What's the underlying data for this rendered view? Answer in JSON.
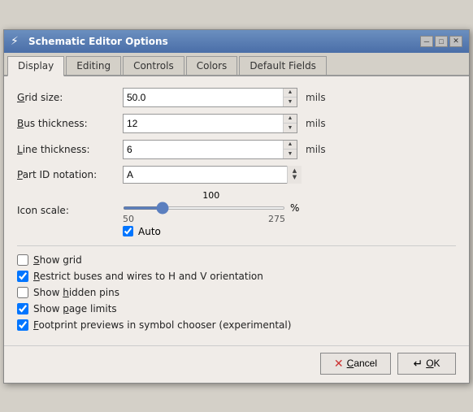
{
  "window": {
    "title": "Schematic Editor Options",
    "icon": "⚙"
  },
  "titlebar_buttons": {
    "minimize": "─",
    "maximize": "□",
    "close": "✕"
  },
  "tabs": [
    {
      "id": "display",
      "label": "Display",
      "underline": "D",
      "active": true
    },
    {
      "id": "editing",
      "label": "Editing",
      "underline": "E",
      "active": false
    },
    {
      "id": "controls",
      "label": "Controls",
      "underline": "C",
      "active": false
    },
    {
      "id": "colors",
      "label": "Colors",
      "underline": "o",
      "active": false
    },
    {
      "id": "default-fields",
      "label": "Default Fields",
      "underline": "F",
      "active": false
    }
  ],
  "form": {
    "grid_size_label": "Grid size:",
    "grid_size_value": "50.0",
    "grid_size_unit": "mils",
    "bus_thickness_label": "Bus thickness:",
    "bus_thickness_value": "12",
    "bus_thickness_unit": "mils",
    "line_thickness_label": "Line thickness:",
    "line_thickness_value": "6",
    "line_thickness_unit": "mils",
    "part_id_label": "Part ID notation:",
    "part_id_value": "A",
    "icon_scale_label": "Icon scale:",
    "icon_scale_value": "100",
    "icon_scale_min": "50",
    "icon_scale_max": "275",
    "icon_scale_unit": "%",
    "auto_label": "Auto",
    "auto_checked": true
  },
  "checkboxes": [
    {
      "id": "show-grid",
      "label": "Show grid",
      "checked": false,
      "underline": "S"
    },
    {
      "id": "restrict-buses",
      "label": "Restrict buses and wires to H and V orientation",
      "checked": true,
      "underline": "R"
    },
    {
      "id": "show-hidden",
      "label": "Show hidden pins",
      "checked": false,
      "underline": "h"
    },
    {
      "id": "show-page",
      "label": "Show page limits",
      "checked": true,
      "underline": "p"
    },
    {
      "id": "footprint-previews",
      "label": "Footprint previews in symbol chooser (experimental)",
      "checked": true,
      "underline": "F"
    }
  ],
  "buttons": {
    "cancel_label": "Cancel",
    "cancel_icon": "✕",
    "ok_label": "OK",
    "ok_icon": "↵"
  }
}
